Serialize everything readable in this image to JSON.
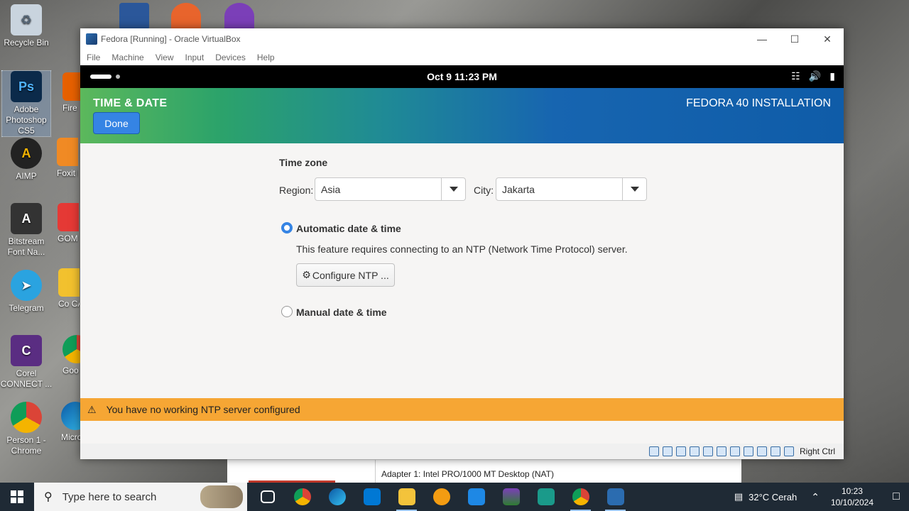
{
  "desktop": {
    "icons": [
      {
        "label": "Recycle Bin"
      },
      {
        "label": "Adobe Photoshop CS5"
      },
      {
        "label": "AIMP"
      },
      {
        "label": "Bitstream Font Na..."
      },
      {
        "label": "Telegram"
      },
      {
        "label": "Corel CONNECT ..."
      },
      {
        "label": "Person 1 - Chrome"
      }
    ],
    "partial_icons": [
      {
        "label": "Fire"
      },
      {
        "label": "Foxit F"
      },
      {
        "label": "GOM"
      },
      {
        "label": "Co CAPTU"
      },
      {
        "label": "Goo Chro"
      },
      {
        "label": "Micro Ed"
      }
    ]
  },
  "vbox": {
    "title": "Fedora [Running] - Oracle VirtualBox",
    "menu": [
      "File",
      "Machine",
      "View",
      "Input",
      "Devices",
      "Help"
    ],
    "status_host_key": "Right Ctrl"
  },
  "gnome": {
    "clock": "Oct 9  11:23 PM",
    "tray": [
      "network-icon",
      "volume-icon",
      "power-icon"
    ]
  },
  "anaconda": {
    "spoke_title": "TIME & DATE",
    "product": "FEDORA 40 INSTALLATION",
    "done_label": "Done",
    "timezone_label": "Time zone",
    "region_label": "Region:",
    "region_value": "Asia",
    "city_label": "City:",
    "city_value": "Jakarta",
    "auto_label": "Automatic date & time",
    "auto_selected": true,
    "auto_desc": "This feature requires connecting to an NTP (Network Time Protocol) server.",
    "ntp_button": "Configure NTP ...",
    "manual_label": "Manual date & time",
    "warning": "You have no working NTP server configured"
  },
  "behind_window": {
    "adapter_text": "Adapter 1:   Intel PRO/1000 MT Desktop (NAT)"
  },
  "taskbar": {
    "search_placeholder": "Type here to search",
    "weather": "32°C  Cerah",
    "time": "10:23",
    "date": "10/10/2024"
  }
}
